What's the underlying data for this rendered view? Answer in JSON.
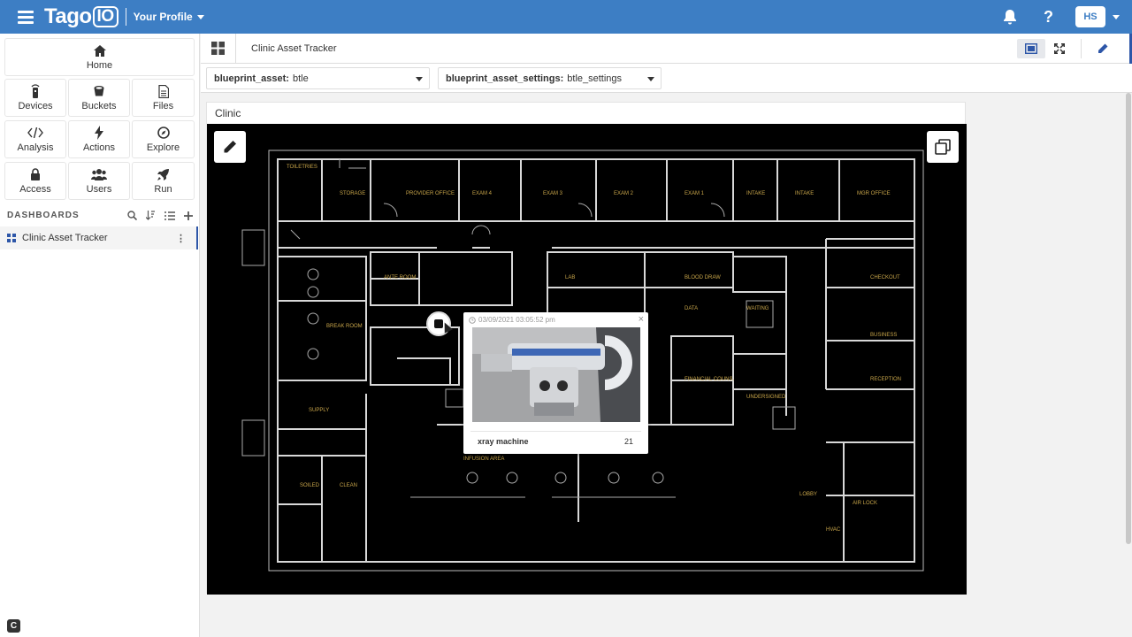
{
  "topbar": {
    "logo_main": "Tago",
    "logo_io": "IO",
    "profile_label": "Your Profile",
    "help_label": "?",
    "avatar_initials": "HS"
  },
  "sidebar": {
    "home": {
      "label": "Home",
      "icon": "home-icon"
    },
    "tiles": [
      {
        "label": "Devices",
        "icon": "device-icon"
      },
      {
        "label": "Buckets",
        "icon": "bucket-icon"
      },
      {
        "label": "Files",
        "icon": "file-icon"
      },
      {
        "label": "Analysis",
        "icon": "code-icon"
      },
      {
        "label": "Actions",
        "icon": "lightning-icon"
      },
      {
        "label": "Explore",
        "icon": "compass-icon"
      },
      {
        "label": "Access",
        "icon": "lock-icon"
      },
      {
        "label": "Users",
        "icon": "users-icon"
      },
      {
        "label": "Run",
        "icon": "rocket-icon"
      }
    ],
    "dashboards_heading": "DASHBOARDS",
    "dashboard_items": [
      {
        "label": "Clinic Asset Tracker"
      }
    ],
    "bottom_badge": "C"
  },
  "dashboard": {
    "title": "Clinic Asset Tracker"
  },
  "filters": [
    {
      "key": "blueprint_asset:",
      "value": "btle"
    },
    {
      "key": "blueprint_asset_settings:",
      "value": "btle_settings"
    }
  ],
  "widget": {
    "title": "Clinic",
    "popup": {
      "timestamp": "03/09/2021 03:05:52 pm",
      "close": "×",
      "asset_name": "xray machine",
      "value": "21"
    }
  },
  "colors": {
    "topbar": "#3d7ec4",
    "accent": "#2d56a8",
    "blueprint_bg": "#000000",
    "blueprint_lines": "#d8d8d8",
    "blueprint_labels": "#c9a64a"
  }
}
